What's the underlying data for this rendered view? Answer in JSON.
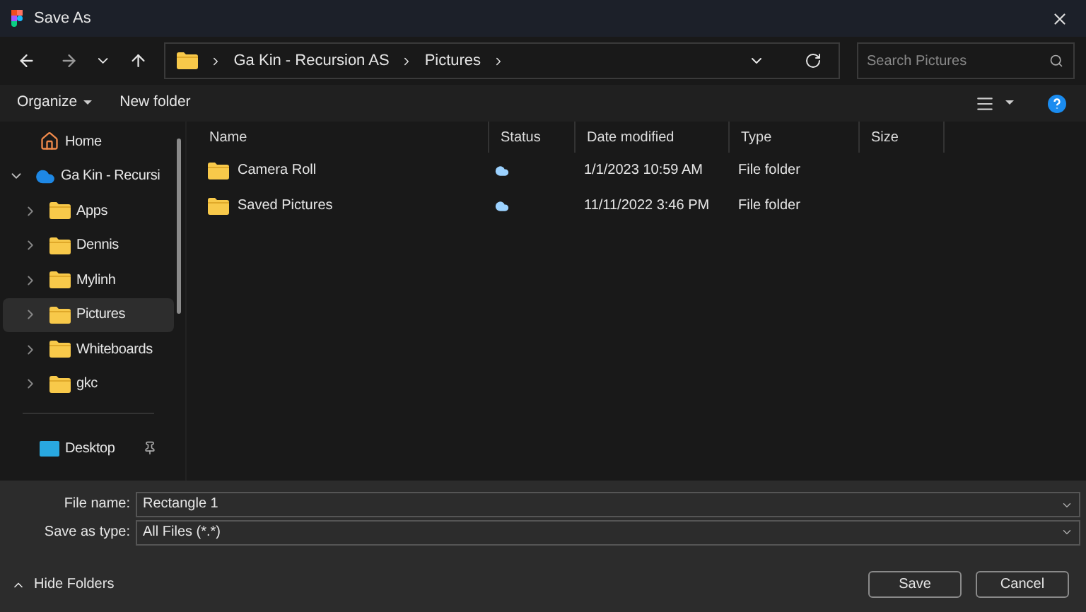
{
  "window": {
    "title": "Save As"
  },
  "address": {
    "segments": [
      "Ga Kin - Recursion AS",
      "Pictures"
    ]
  },
  "search": {
    "placeholder": "Search Pictures"
  },
  "toolbar": {
    "organize": "Organize",
    "new_folder": "New folder"
  },
  "sidebar": {
    "items": [
      {
        "label": "Home",
        "kind": "home",
        "selected": false
      },
      {
        "label": "Ga Kin - Recursi",
        "kind": "cloud",
        "selected": false,
        "expanded": true,
        "children": [
          {
            "label": "Apps",
            "kind": "folder",
            "selected": false,
            "expanded": false
          },
          {
            "label": "Dennis",
            "kind": "folder",
            "selected": false,
            "expanded": false
          },
          {
            "label": "Mylinh",
            "kind": "folder",
            "selected": false,
            "expanded": false
          },
          {
            "label": "Pictures",
            "kind": "folder",
            "selected": true,
            "expanded": false
          },
          {
            "label": "Whiteboards",
            "kind": "folder",
            "selected": false,
            "expanded": false
          },
          {
            "label": "gkc",
            "kind": "folder",
            "selected": false,
            "expanded": false
          }
        ]
      },
      {
        "label": "Desktop",
        "kind": "pinned",
        "selected": false
      }
    ]
  },
  "table": {
    "columns": [
      "Name",
      "Status",
      "Date modified",
      "Type",
      "Size"
    ],
    "rows": [
      {
        "name": "Camera Roll",
        "date": "1/1/2023 10:59 AM",
        "type": "File folder"
      },
      {
        "name": "Saved Pictures",
        "date": "11/11/2022 3:46 PM",
        "type": "File folder"
      }
    ]
  },
  "form": {
    "file_name_label": "File name:",
    "file_name": "Rectangle 1",
    "type_label": "Save as type:",
    "type": "All Files (*.*)"
  },
  "footer": {
    "hide_folders": "Hide Folders",
    "buttons": [
      "Save",
      "Cancel"
    ]
  }
}
